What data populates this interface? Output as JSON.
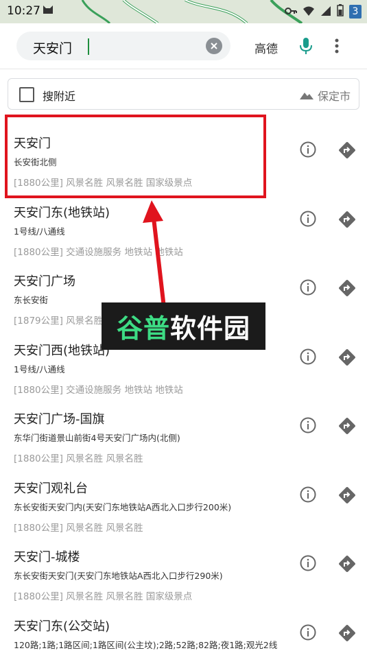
{
  "status_bar": {
    "time": "10:27",
    "badge": "3"
  },
  "search": {
    "query": "天安门",
    "engine_label": "高德"
  },
  "nearby": {
    "label": "搜附近",
    "city": "保定市"
  },
  "results": [
    {
      "name": "天安门",
      "address": "长安街北侧",
      "meta": "[1880公里] 风景名胜 风景名胜 国家级景点"
    },
    {
      "name": "天安门东(地铁站)",
      "address": "1号线/八通线",
      "meta": "[1880公里] 交通设施服务 地铁站 地铁站"
    },
    {
      "name": "天安门广场",
      "address": "东长安街",
      "meta": "[1879公里] 风景名胜 风景名胜 公园广场 城市广场"
    },
    {
      "name": "天安门西(地铁站)",
      "address": "1号线/八通线",
      "meta": "[1880公里] 交通设施服务 地铁站 地铁站"
    },
    {
      "name": "天安门广场-国旗",
      "address": "东华门街道景山前街4号天安门广场内(北侧)",
      "meta": "[1880公里] 风景名胜 风景名胜"
    },
    {
      "name": "天安门观礼台",
      "address": "东长安街天安门内(天安门东地铁站A西北入口步行200米)",
      "meta": "[1880公里] 风景名胜 风景名胜"
    },
    {
      "name": "天安门-城楼",
      "address": "东长安街天安门(天安门东地铁站A西北入口步行290米)",
      "meta": "[1880公里] 风景名胜 风景名胜 国家级景点"
    },
    {
      "name": "天安门东(公交站)",
      "address": "120路;1路;1路区间;1路区间(公主坟);2路;52路;82路;夜1路;观光2线",
      "meta": ""
    }
  ],
  "watermark": {
    "part1": "谷普",
    "part2": "软件园"
  }
}
